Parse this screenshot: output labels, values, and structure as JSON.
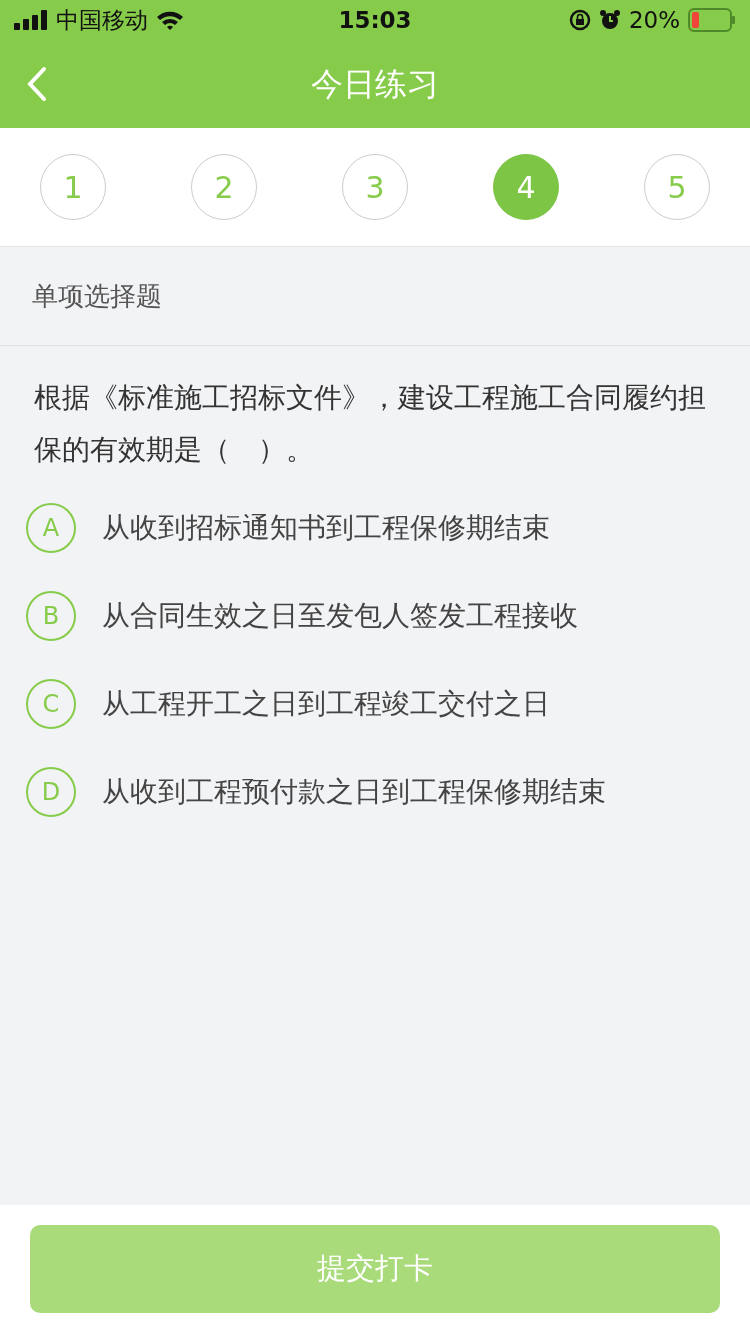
{
  "status_bar": {
    "carrier": "中国移动",
    "time": "15:03",
    "battery": "20%"
  },
  "nav": {
    "title": "今日练习"
  },
  "steps": [
    {
      "label": "1",
      "selected": false
    },
    {
      "label": "2",
      "selected": false
    },
    {
      "label": "3",
      "selected": false
    },
    {
      "label": "4",
      "selected": true
    },
    {
      "label": "5",
      "selected": false
    }
  ],
  "question_type": "单项选择题",
  "question": "根据《标准施工招标文件》，建设工程施工合同履约担保的有效期是（　）。",
  "options": [
    {
      "letter": "A",
      "text": "从收到招标通知书到工程保修期结束",
      "selected": false
    },
    {
      "letter": "B",
      "text": "从合同生效之日至发包人签发工程接收",
      "selected": false
    },
    {
      "letter": "C",
      "text": "从工程开工之日到工程竣工交付之日",
      "selected": false
    },
    {
      "letter": "D",
      "text": "从收到工程预付款之日到工程保修期结束",
      "selected": false
    }
  ],
  "submit": {
    "label": "提交打卡",
    "disabled": true
  }
}
